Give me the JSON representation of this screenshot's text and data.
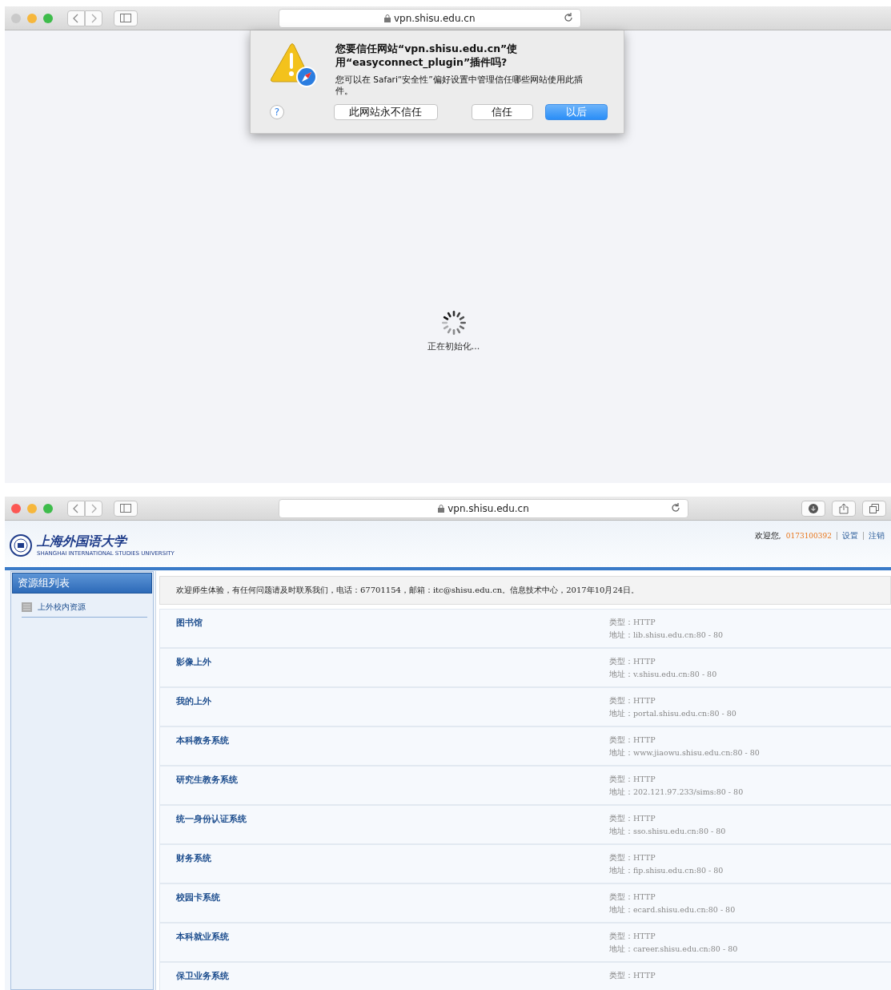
{
  "windows": [
    {
      "toolbar": {
        "traffic_lights": [
          {
            "color": "#c9c9c9"
          },
          {
            "color": "#f6b73c"
          },
          {
            "color": "#3ebc4b"
          }
        ],
        "address": "vpn.shisu.edu.cn",
        "right_icons": false
      },
      "dialog": {
        "title": "您要信任网站“vpn.shisu.edu.cn”使用“easyconnect_plugin”插件吗?",
        "message": "您可以在 Safari“安全性”偏好设置中管理信任哪些网站使用此插件。",
        "help": "?",
        "buttons": [
          {
            "label": "此网站永不信任",
            "selected": false
          },
          {
            "label": "信任",
            "selected": false
          },
          {
            "label": "以后",
            "selected": true
          }
        ]
      },
      "loading": {
        "text": "正在初始化..."
      }
    },
    {
      "toolbar": {
        "traffic_lights": [
          {
            "color": "#fc5753"
          },
          {
            "color": "#f6b73c"
          },
          {
            "color": "#3ebc4b"
          }
        ],
        "address": "vpn.shisu.edu.cn",
        "right_icons": true
      },
      "portal": {
        "logo_title": "上海外国语大学",
        "logo_subtitle": "SHANGHAI INTERNATIONAL STUDIES UNIVERSITY",
        "welcome": "欢迎您,",
        "user": "0173100392",
        "links": [
          "设置",
          "注销"
        ],
        "sidebar": {
          "title": "资源组列表",
          "items": [
            {
              "label": "上外校内资源",
              "selected": true
            }
          ]
        },
        "notice": "欢迎师生体验，有任何问题请及时联系我们，电话：67701154，邮箱：itc@shisu.edu.cn。信息技术中心，2017年10月24日。",
        "resources": [
          {
            "name": "图书馆",
            "type": "类型：HTTP",
            "address": "地址：lib.shisu.edu.cn:80 - 80"
          },
          {
            "name": "影像上外",
            "type": "类型：HTTP",
            "address": "地址：v.shisu.edu.cn:80 - 80"
          },
          {
            "name": "我的上外",
            "type": "类型：HTTP",
            "address": "地址：portal.shisu.edu.cn:80 - 80"
          },
          {
            "name": "本科教务系统",
            "type": "类型：HTTP",
            "address": "地址：www.jiaowu.shisu.edu.cn:80 - 80"
          },
          {
            "name": "研究生教务系统",
            "type": "类型：HTTP",
            "address": "地址：202.121.97.233/sims:80 - 80"
          },
          {
            "name": "统一身份认证系统",
            "type": "类型：HTTP",
            "address": "地址：sso.shisu.edu.cn:80 - 80"
          },
          {
            "name": "财务系统",
            "type": "类型：HTTP",
            "address": "地址：fip.shisu.edu.cn:80 - 80"
          },
          {
            "name": "校园卡系统",
            "type": "类型：HTTP",
            "address": "地址：ecard.shisu.edu.cn:80 - 80"
          },
          {
            "name": "本科就业系统",
            "type": "类型：HTTP",
            "address": "地址：career.shisu.edu.cn:80 - 80"
          },
          {
            "name": "保卫业务系统",
            "type": "类型：HTTP"
          }
        ]
      }
    }
  ]
}
